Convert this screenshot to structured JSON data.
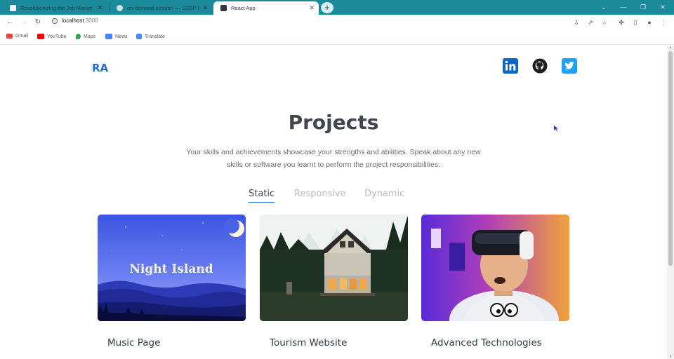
{
  "browser": {
    "tabs": [
      {
        "title": "Revolutionizing the Job Market |",
        "active": false
      },
      {
        "title": "on-demand-session — CCBP IDE",
        "active": false
      },
      {
        "title": "React App",
        "active": true
      }
    ],
    "url_host": "localhost",
    "url_port": ":3000",
    "bookmarks": [
      {
        "label": "Gmail",
        "icon": "gmail-icon"
      },
      {
        "label": "YouTube",
        "icon": "youtube-icon"
      },
      {
        "label": "Maps",
        "icon": "maps-icon"
      },
      {
        "label": "News",
        "icon": "news-icon"
      },
      {
        "label": "Translate",
        "icon": "translate-icon"
      }
    ]
  },
  "header": {
    "logo": "RA",
    "social": [
      "linkedin-icon",
      "github-icon",
      "twitter-icon"
    ]
  },
  "projects": {
    "title": "Projects",
    "description_line1": "Your skills and achievements showcase your strengths and abilities. Speak about any new",
    "description_line2": "skills or software you learnt to perform the project responsibilities.",
    "tabs": [
      {
        "label": "Static",
        "active": true
      },
      {
        "label": "Responsive",
        "active": false
      },
      {
        "label": "Dynamic",
        "active": false
      }
    ],
    "cards": [
      {
        "title": "Music Page",
        "image_text": "Night Island"
      },
      {
        "title": "Tourism Website",
        "image_text": ""
      },
      {
        "title": "Advanced Technologies",
        "image_text": ""
      }
    ]
  },
  "colors": {
    "tabstrip": "#1b8a9a",
    "accent": "#1d6fd0",
    "linkedin": "#0a66c2",
    "twitter": "#1da1f2"
  }
}
